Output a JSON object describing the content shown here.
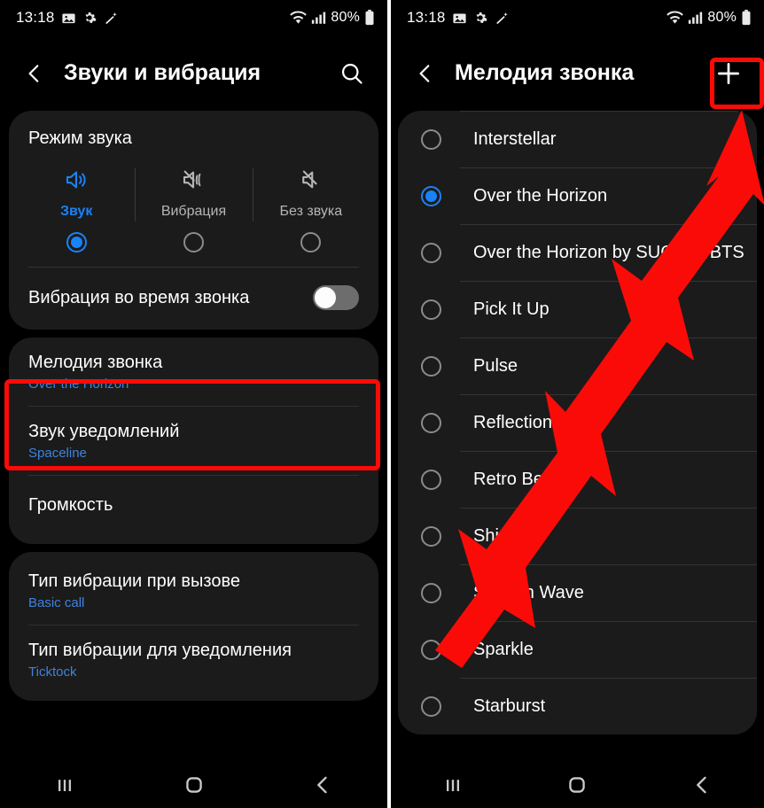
{
  "status_bar": {
    "time": "13:18",
    "battery_text": "80%",
    "icons": [
      "image-icon",
      "gear-icon",
      "magic-wand-icon",
      "wifi-icon",
      "signal-icon",
      "battery-icon"
    ]
  },
  "colors": {
    "accent_blue": "#1a82f7",
    "link_blue": "#3f82dc",
    "highlight_red": "#fb0b08",
    "card_bg": "#1b1b1b",
    "page_bg": "#000000"
  },
  "left_screen": {
    "title": "Звуки и вибрация",
    "back_icon": "chevron-left-icon",
    "search_icon": "search-icon",
    "sound_mode": {
      "title": "Режим звука",
      "options": [
        {
          "label": "Звук",
          "icon": "speaker-on-icon",
          "selected": true
        },
        {
          "label": "Вибрация",
          "icon": "speaker-vibrate-icon",
          "selected": false
        },
        {
          "label": "Без звука",
          "icon": "speaker-mute-icon",
          "selected": false
        }
      ],
      "vibrate_while_ringing": {
        "label": "Вибрация во время звонка",
        "enabled": false
      }
    },
    "settings_rows": [
      {
        "title": "Мелодия звонка",
        "value": "Over the Horizon",
        "highlighted": true
      },
      {
        "title": "Звук уведомлений",
        "value": "Spaceline",
        "highlighted": false
      },
      {
        "title": "Громкость",
        "value": "",
        "highlighted": false
      }
    ],
    "vibration_rows": [
      {
        "title": "Тип вибрации при вызове",
        "value": "Basic call"
      },
      {
        "title": "Тип вибрации для уведомления",
        "value": "Ticktock"
      }
    ]
  },
  "right_screen": {
    "title": "Мелодия звонка",
    "back_icon": "chevron-left-icon",
    "add_icon": "plus-icon",
    "add_button_highlighted": true,
    "ringtones": [
      {
        "label": "Interstellar",
        "selected": false
      },
      {
        "label": "Over the Horizon",
        "selected": true
      },
      {
        "label": "Over the Horizon by SUGA of BTS",
        "selected": false
      },
      {
        "label": "Pick It Up",
        "selected": false
      },
      {
        "label": "Pulse",
        "selected": false
      },
      {
        "label": "Reflection",
        "selected": false
      },
      {
        "label": "Retro Beep",
        "selected": false
      },
      {
        "label": "Shimmer",
        "selected": false
      },
      {
        "label": "Smooth Wave",
        "selected": false
      },
      {
        "label": "Sparkle",
        "selected": false
      },
      {
        "label": "Starburst",
        "selected": false
      }
    ]
  },
  "nav_bar": {
    "recents_icon": "recents-icon",
    "home_icon": "home-icon",
    "back_icon": "back-chevron-icon"
  },
  "annotation": {
    "arrow": "red-arrow-pointing-to-add-button"
  }
}
